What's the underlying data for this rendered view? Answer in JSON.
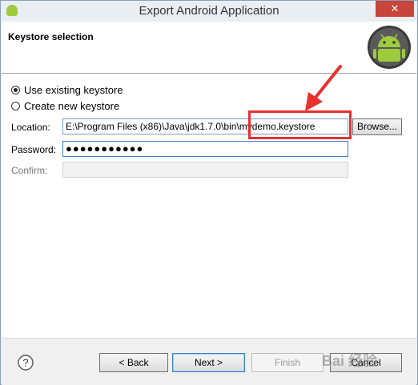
{
  "window": {
    "title": "Export Android Application",
    "close_label": "✕"
  },
  "header": {
    "section_title": "Keystore selection"
  },
  "options": {
    "use_existing": "Use existing keystore",
    "create_new": "Create new keystore",
    "selected": "use_existing"
  },
  "form": {
    "location_label": "Location:",
    "location_value": "E:\\Program Files (x86)\\Java\\jdk1.7.0\\bin\\mydemo.keystore",
    "browse_label": "Browse...",
    "password_label": "Password:",
    "password_mask": "●●●●●●●●●●●",
    "confirm_label": "Confirm:",
    "confirm_value": ""
  },
  "footer": {
    "help_icon": "question-circle-icon",
    "back_label": "< Back",
    "next_label": "Next >",
    "finish_label": "Finish",
    "cancel_label": "Cancel",
    "watermark": "Bai 经验"
  },
  "colors": {
    "highlight": "#e8302f",
    "accent": "#3c7fc7",
    "android_green": "#9ccc3e"
  }
}
